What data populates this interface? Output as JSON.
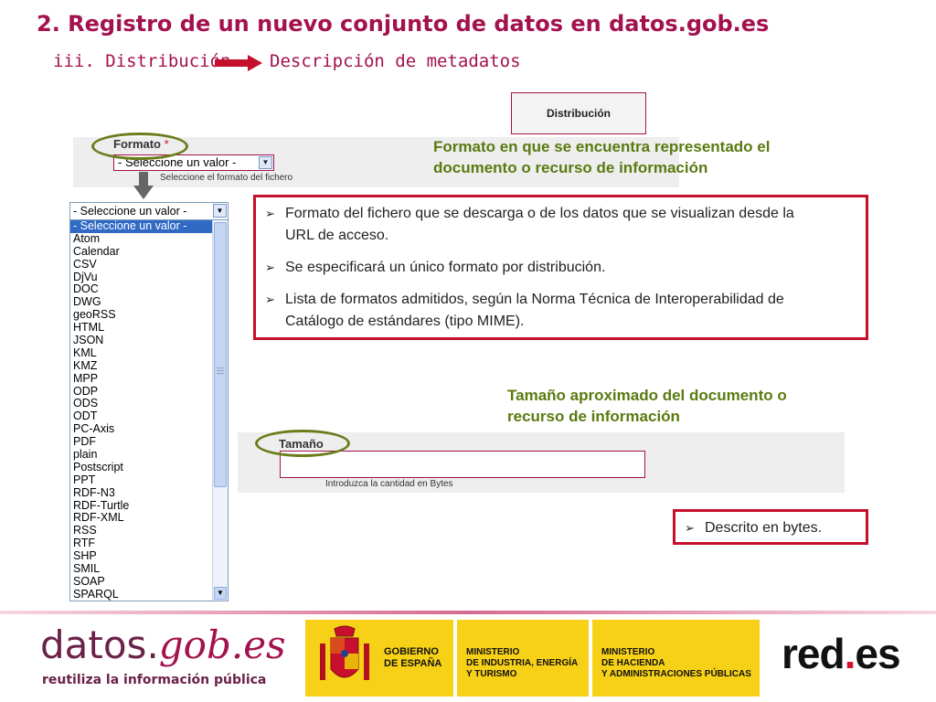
{
  "slide": {
    "title": "2. Registro de un nuevo conjunto de datos en datos.gob.es",
    "subtitle_left": "iii. Distribución",
    "subtitle_right": "Descripción de metadatos"
  },
  "form": {
    "distribution_tab": "Distribución",
    "formato": {
      "label": "Formato",
      "required_mark": "*",
      "selected_value": "- Seleccione un valor -",
      "hint": "Seleccione el formato del fichero",
      "listbox_top": "- Seleccione un valor -",
      "options": [
        "- Seleccione un valor -",
        "Atom",
        "Calendar",
        "CSV",
        "DjVu",
        "DOC",
        "DWG",
        "geoRSS",
        "HTML",
        "JSON",
        "KML",
        "KMZ",
        "MPP",
        "ODP",
        "ODS",
        "ODT",
        "PC-Axis",
        "PDF",
        "plain",
        "Postscript",
        "PPT",
        "RDF-N3",
        "RDF-Turtle",
        "RDF-XML",
        "RSS",
        "RTF",
        "SHP",
        "SMIL",
        "SOAP",
        "SPARQL"
      ]
    },
    "tamano": {
      "label": "Tamaño",
      "value": "",
      "hint": "Introduzca la cantidad en Bytes"
    }
  },
  "notes": {
    "formato_line1": "Formato en que se encuentra representado el",
    "formato_line2": "documento o recurso de información",
    "tamano_line1": "Tamaño aproximado del documento o",
    "tamano_line2": "recurso de información"
  },
  "bullets_formato": [
    {
      "line1": "Formato del fichero que se descarga o de los datos que se visualizan desde la",
      "line2": "URL de acceso."
    },
    {
      "line1": "Se especificará un único formato por distribución.",
      "line2": ""
    },
    {
      "line1": "Lista de formatos admitidos, según la Norma Técnica de Interoperabilidad de",
      "line2": "Catálogo de estándares (tipo MIME)."
    }
  ],
  "bullet_tamano": "Descrito en bytes.",
  "footer": {
    "brand_main": "datos.",
    "brand_accent": "gob.es",
    "brand_tag": "reutiliza la información pública",
    "gov_1_line1": "GOBIERNO",
    "gov_1_line2": "DE ESPAÑA",
    "gov_2_line1": "MINISTERIO",
    "gov_2_line2": "DE INDUSTRIA, ENERGÍA",
    "gov_2_line3": "Y TURISMO",
    "gov_3_line1": "MINISTERIO",
    "gov_3_line2": "DE HACIENDA",
    "gov_3_line3": "Y ADMINISTRACIONES PÚBLICAS",
    "redes_main": "red",
    "redes_dot": ".",
    "redes_end": "es"
  },
  "colors": {
    "title": "#a3124e",
    "note_green": "#5b7a10",
    "box_red": "#c4102a",
    "gov_yellow": "#f7d117"
  }
}
